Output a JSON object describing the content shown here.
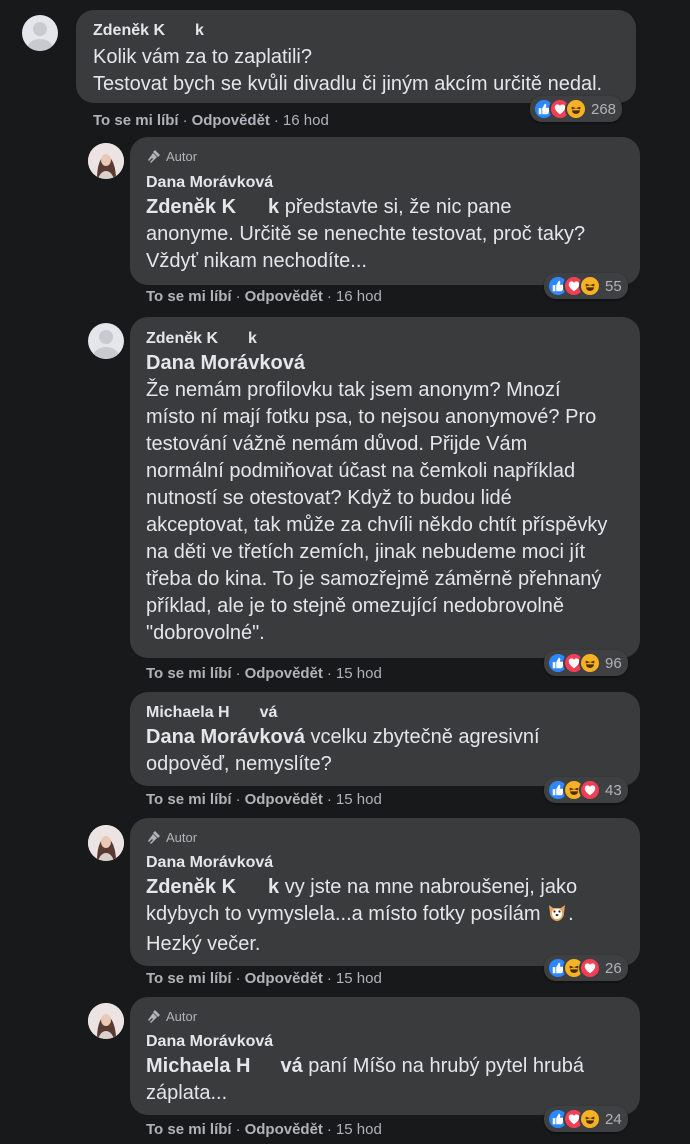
{
  "actions": {
    "like": "To se mi líbí",
    "reply": "Odpovědět",
    "separator": "·"
  },
  "author_badge": "Autor",
  "comments": [
    {
      "name": "Zdeněk K",
      "name_suffix": "k",
      "lines": [
        "Kolik vám za to zaplatili?",
        "Testovat bych se kvůli divadlu či jiným akcím určitě nedal."
      ],
      "time": "16 hod",
      "reaction_count": "268"
    },
    {
      "name": "Dana Morávková",
      "mention": "Zdeněk K",
      "mention_suffix": "k",
      "lines": [
        "představte si, že nic pane",
        "anonyme. Určitě se nenechte testovat, proč taky?",
        "Vždyť nikam nechodíte..."
      ],
      "time": "16 hod",
      "reaction_count": "55"
    },
    {
      "name": "Zdeněk K",
      "name_suffix": "k",
      "mention": "Dana Morávková",
      "lines": [
        "Že nemám profilovku tak jsem anonym? Mnozí",
        "místo ní mají fotku psa, to nejsou anonymové? Pro",
        "testování vážně nemám důvod. Přijde Vám",
        "normální podmiňovat účast na čemkoli například",
        "nutností se otestovat? Když to budou lidé",
        "akceptovat, tak může za chvíli někdo chtít příspěvky",
        "na děti ve třetích zemích, jinak nebudeme moci jít",
        "třeba do kina. To je samozřejmě záměrně přehnaný",
        "příklad, ale je to stejně omezující nedobrovolně",
        "\"dobrovolné\"."
      ],
      "time": "15 hod",
      "reaction_count": "96"
    },
    {
      "name": "Michaela H",
      "name_suffix": "vá",
      "mention": "Dana Morávková",
      "lines": [
        "vcelku zbytečně agresivní",
        "odpověď, nemyslíte?"
      ],
      "time": "15 hod",
      "reaction_count": "43"
    },
    {
      "name": "Dana Morávková",
      "mention": "Zdeněk K",
      "mention_suffix": "k",
      "lines": [
        "vy jste na mne nabroušenej, jako",
        "kdybych to vymyslela...a místo fotky posílám",
        "Hezký večer."
      ],
      "time": "15 hod",
      "reaction_count": "26"
    },
    {
      "name": "Dana Morávková",
      "mention": "Michaela H",
      "mention_suffix": "vá",
      "lines": [
        "paní Míšo na hrubý pytel hrubá",
        "záplata..."
      ],
      "time": "15 hod",
      "reaction_count": "24"
    }
  ],
  "colors": {
    "background": "#18191a",
    "bubble": "#3a3b3c",
    "text": "#e4e6eb",
    "secondary": "#b0b3b8",
    "like": "#2d88ff",
    "love": "#f33e58",
    "haha": "#f7b125"
  },
  "icons": {
    "author": "microphone-icon",
    "like": "thumbs-up-icon",
    "love": "heart-icon",
    "haha": "laughing-face-icon",
    "dog": "dog-face-emoji"
  }
}
